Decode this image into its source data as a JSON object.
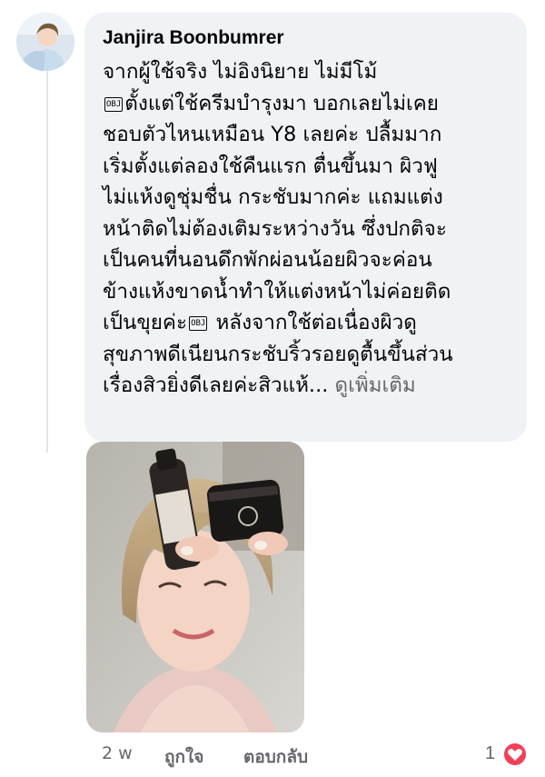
{
  "comment": {
    "author": "Janjira Boonbumrer",
    "lines": [
      "จากผู้ใช้จริง ไม่อิงนิยาย ไม่มีโม้",
      "ตั้งแต่ใช้ครีมบำรุงมา บอกเลยไม่เคย",
      "ชอบตัวไหนเหมือน Y8 เลยค่ะ ปลื้มมาก",
      "เริ่มตั้งแต่ลองใช้คืนแรก ตื่นขึ้นมา ผิวฟู",
      "ไม่แห้งดูชุ่มชื่น กระชับมากค่ะ แถมแต่ง",
      "หน้าติดไม่ต้องเติมระหว่างวัน ซึ่งปกติจะ",
      "เป็นคนที่นอนดึกพักผ่อนน้อยผิวจะค่อน",
      "ข้างแห้งขาดน้ำทำให้แต่งหน้าไม่ค่อยติด",
      "เป็นขุยค่ะ",
      " หลังจากใช้ต่อเนื่องผิวดู",
      "สุขภาพดีเนียนกระชับริ้วรอยดูตื้นขึ้นส่วน",
      "เรื่องสิวยิ่งดีเลยค่ะสิวแห้...",
      "ดูเพิ่มเติม"
    ],
    "obj_glyph": "OBJ"
  },
  "actions": {
    "time": "2 w",
    "like_label": "ถูกใจ",
    "reply_label": "ตอบกลับ",
    "reaction_count": "1"
  },
  "icons": {
    "reaction": "heart-icon"
  },
  "colors": {
    "bubble": "#f0f2f5",
    "text": "#050505",
    "secondary": "#65676b",
    "heart": "#f33e58"
  }
}
